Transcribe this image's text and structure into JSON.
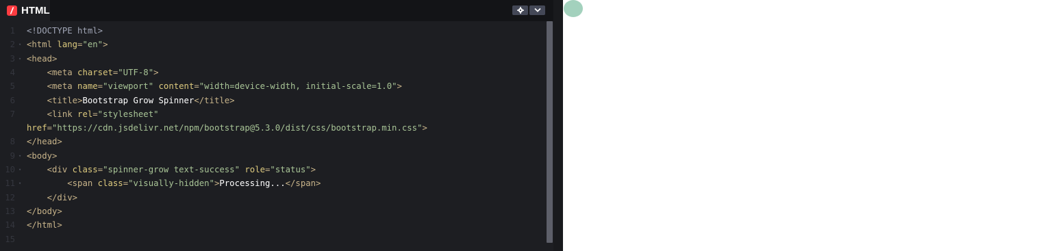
{
  "editor": {
    "language_label": "HTML",
    "language_icon": "codepen-html-icon",
    "accent_color": "#ff3c41",
    "line_numbers": [
      "1",
      "2",
      "3",
      "4",
      "5",
      "6",
      "7",
      "",
      "8",
      "9",
      "10",
      "11",
      "12",
      "13",
      "14",
      "15"
    ],
    "lines": [
      [
        {
          "c": "doc",
          "t": "<!DOCTYPE html>"
        }
      ],
      [
        {
          "c": "tag",
          "t": "<html "
        },
        {
          "c": "attr",
          "t": "lang"
        },
        {
          "c": "tag",
          "t": "="
        },
        {
          "c": "str",
          "t": "\"en\""
        },
        {
          "c": "tag",
          "t": ">"
        }
      ],
      [
        {
          "c": "tag",
          "t": "<head>"
        }
      ],
      [
        {
          "c": "text",
          "t": "    "
        },
        {
          "c": "tag",
          "t": "<meta "
        },
        {
          "c": "attr",
          "t": "charset"
        },
        {
          "c": "tag",
          "t": "="
        },
        {
          "c": "str",
          "t": "\"UTF-8\""
        },
        {
          "c": "tag",
          "t": ">"
        }
      ],
      [
        {
          "c": "text",
          "t": "    "
        },
        {
          "c": "tag",
          "t": "<meta "
        },
        {
          "c": "attr",
          "t": "name"
        },
        {
          "c": "tag",
          "t": "="
        },
        {
          "c": "str",
          "t": "\"viewport\""
        },
        {
          "c": "tag",
          "t": " "
        },
        {
          "c": "attr",
          "t": "content"
        },
        {
          "c": "tag",
          "t": "="
        },
        {
          "c": "str",
          "t": "\"width=device-width, initial-scale=1.0\""
        },
        {
          "c": "tag",
          "t": ">"
        }
      ],
      [
        {
          "c": "text",
          "t": "    "
        },
        {
          "c": "tag",
          "t": "<title>"
        },
        {
          "c": "text",
          "t": "Bootstrap Grow Spinner"
        },
        {
          "c": "tag",
          "t": "</title>"
        }
      ],
      [
        {
          "c": "text",
          "t": "    "
        },
        {
          "c": "tag",
          "t": "<link "
        },
        {
          "c": "attr",
          "t": "rel"
        },
        {
          "c": "tag",
          "t": "="
        },
        {
          "c": "str",
          "t": "\"stylesheet\""
        }
      ],
      [
        {
          "c": "attr",
          "t": "href"
        },
        {
          "c": "tag",
          "t": "="
        },
        {
          "c": "str",
          "t": "\"https://cdn.jsdelivr.net/npm/bootstrap@5.3.0/dist/css/bootstrap.min.css\""
        },
        {
          "c": "tag",
          "t": ">"
        }
      ],
      [
        {
          "c": "tag",
          "t": "</head>"
        }
      ],
      [
        {
          "c": "tag",
          "t": "<body>"
        }
      ],
      [
        {
          "c": "text",
          "t": "    "
        },
        {
          "c": "tag",
          "t": "<div "
        },
        {
          "c": "attr",
          "t": "class"
        },
        {
          "c": "tag",
          "t": "="
        },
        {
          "c": "str",
          "t": "\"spinner-grow text-success\""
        },
        {
          "c": "tag",
          "t": " "
        },
        {
          "c": "attr",
          "t": "role"
        },
        {
          "c": "tag",
          "t": "="
        },
        {
          "c": "str",
          "t": "\"status\""
        },
        {
          "c": "tag",
          "t": ">"
        }
      ],
      [
        {
          "c": "text",
          "t": "        "
        },
        {
          "c": "tag",
          "t": "<span "
        },
        {
          "c": "attr",
          "t": "class"
        },
        {
          "c": "tag",
          "t": "="
        },
        {
          "c": "str",
          "t": "\"visually-hidden\""
        },
        {
          "c": "tag",
          "t": ">"
        },
        {
          "c": "text",
          "t": "Processing..."
        },
        {
          "c": "tag",
          "t": "</span>"
        }
      ],
      [
        {
          "c": "text",
          "t": "    "
        },
        {
          "c": "tag",
          "t": "</div>"
        }
      ],
      [
        {
          "c": "tag",
          "t": "</body>"
        }
      ],
      [
        {
          "c": "tag",
          "t": "</html>"
        }
      ],
      []
    ],
    "fold_markers": [
      false,
      true,
      true,
      false,
      false,
      false,
      false,
      false,
      false,
      true,
      true,
      true,
      false,
      false,
      false,
      false
    ]
  },
  "toolbar": {
    "settings_icon": "gear-icon",
    "collapse_icon": "chevron-down-icon"
  },
  "preview": {
    "spinner_color": "#a3d1bd",
    "spinner_label": "Processing..."
  }
}
